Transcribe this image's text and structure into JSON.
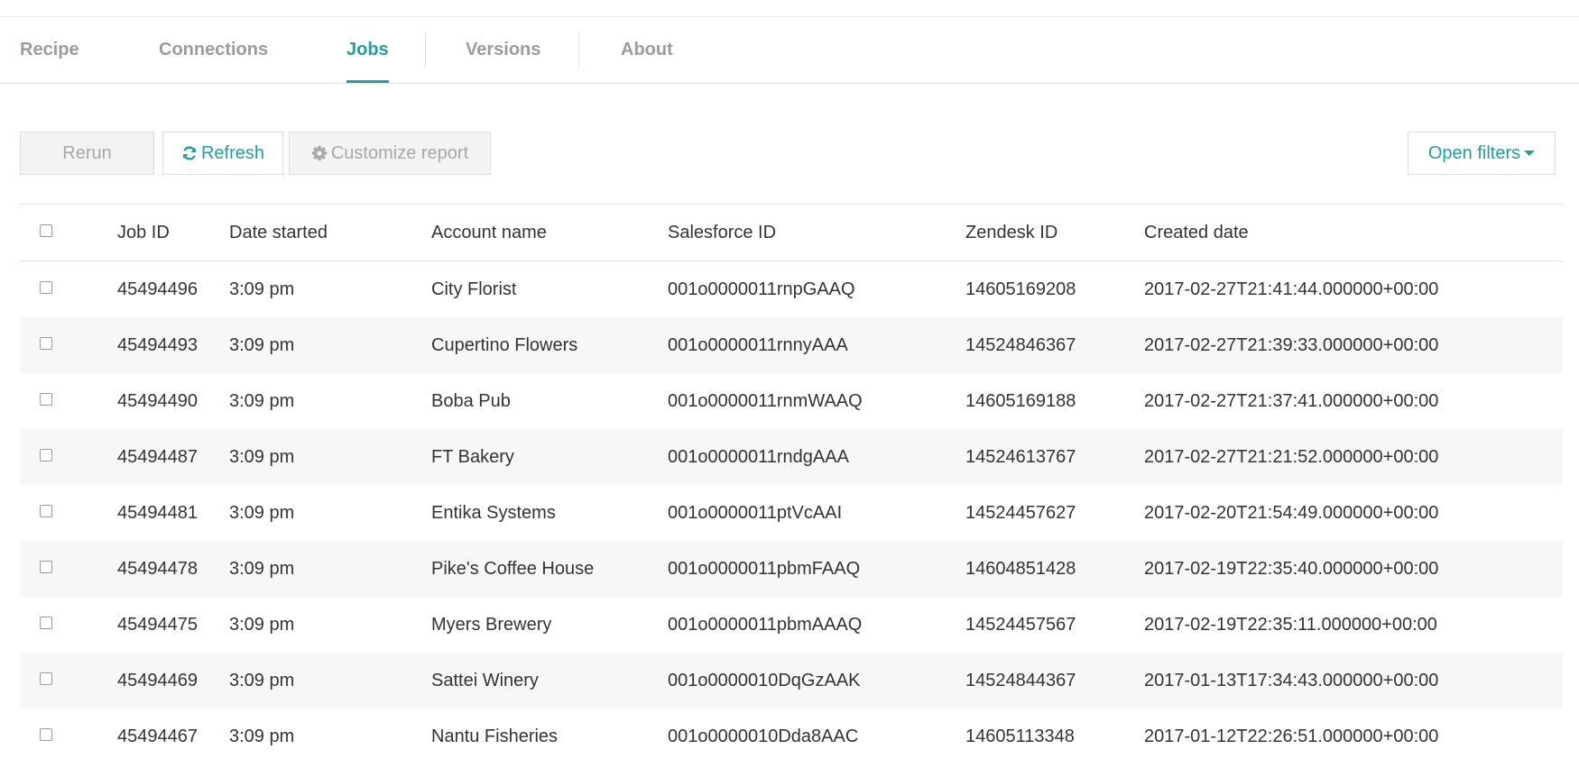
{
  "tabs": [
    {
      "label": "Recipe",
      "active": false
    },
    {
      "label": "Connections",
      "active": false
    },
    {
      "label": "Jobs",
      "active": true
    },
    {
      "label": "Versions",
      "active": false
    },
    {
      "label": "About",
      "active": false
    }
  ],
  "toolbar": {
    "rerun_label": "Rerun",
    "refresh_label": "Refresh",
    "refresh_icon": "refresh-icon",
    "customize_label": "Customize report",
    "customize_icon": "gear-icon",
    "filters_label": "Open filters",
    "filters_icon": "caret-down-icon"
  },
  "colors": {
    "accent": "#1f9fa4",
    "inactive_tab": "#9b9b9b",
    "disabled_text": "#a8a8a8",
    "row_stripe": "#f7f7f7"
  },
  "table": {
    "columns": [
      "Job ID",
      "Date started",
      "Account name",
      "Salesforce ID",
      "Zendesk ID",
      "Created date"
    ],
    "rows": [
      {
        "job_id": "45494496",
        "date_started": "3:09 pm",
        "account": "City Florist",
        "salesforce_id": "001o0000011rnpGAAQ",
        "zendesk_id": "14605169208",
        "created": "2017-02-27T21:41:44.000000+00:00"
      },
      {
        "job_id": "45494493",
        "date_started": "3:09 pm",
        "account": "Cupertino Flowers",
        "salesforce_id": "001o0000011rnnyAAA",
        "zendesk_id": "14524846367",
        "created": "2017-02-27T21:39:33.000000+00:00"
      },
      {
        "job_id": "45494490",
        "date_started": "3:09 pm",
        "account": "Boba Pub",
        "salesforce_id": "001o0000011rnmWAAQ",
        "zendesk_id": "14605169188",
        "created": "2017-02-27T21:37:41.000000+00:00"
      },
      {
        "job_id": "45494487",
        "date_started": "3:09 pm",
        "account": "FT Bakery",
        "salesforce_id": "001o0000011rndgAAA",
        "zendesk_id": "14524613767",
        "created": "2017-02-27T21:21:52.000000+00:00"
      },
      {
        "job_id": "45494481",
        "date_started": "3:09 pm",
        "account": "Entika Systems",
        "salesforce_id": "001o0000011ptVcAAI",
        "zendesk_id": "14524457627",
        "created": "2017-02-20T21:54:49.000000+00:00"
      },
      {
        "job_id": "45494478",
        "date_started": "3:09 pm",
        "account": "Pike's Coffee House",
        "salesforce_id": "001o0000011pbmFAAQ",
        "zendesk_id": "14604851428",
        "created": "2017-02-19T22:35:40.000000+00:00"
      },
      {
        "job_id": "45494475",
        "date_started": "3:09 pm",
        "account": "Myers Brewery",
        "salesforce_id": "001o0000011pbmAAAQ",
        "zendesk_id": "14524457567",
        "created": "2017-02-19T22:35:11.000000+00:00"
      },
      {
        "job_id": "45494469",
        "date_started": "3:09 pm",
        "account": "Sattei Winery",
        "salesforce_id": "001o0000010DqGzAAK",
        "zendesk_id": "14524844367",
        "created": "2017-01-13T17:34:43.000000+00:00"
      },
      {
        "job_id": "45494467",
        "date_started": "3:09 pm",
        "account": "Nantu Fisheries",
        "salesforce_id": "001o0000010Dda8AAC",
        "zendesk_id": "14605113348",
        "created": "2017-01-12T22:26:51.000000+00:00"
      }
    ]
  }
}
